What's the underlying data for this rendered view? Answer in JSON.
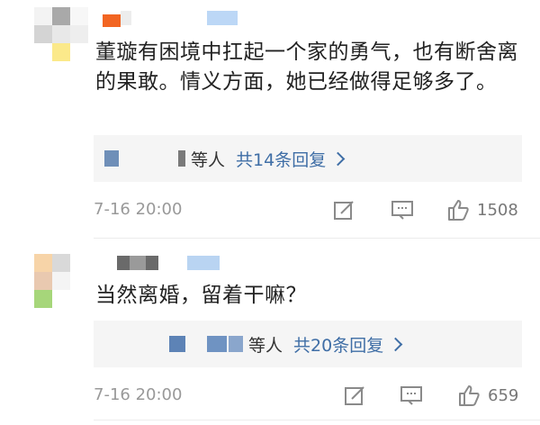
{
  "comments": [
    {
      "text": "董璇有困境中扛起一个家的勇气，也有断舍离的果敢。情义方面，她已经做得足够多了。",
      "reply_who": "等人",
      "reply_link": "共14条回复",
      "time": "7-16 20:00",
      "likes": "1508",
      "icons": [
        "share-icon",
        "comment-icon",
        "like-icon",
        "chevron-right-icon"
      ]
    },
    {
      "text": "当然离婚，留着干嘛？",
      "reply_who": "等人",
      "reply_link": "共20条回复",
      "time": "7-16 20:00",
      "likes": "659",
      "icons": [
        "share-icon",
        "comment-icon",
        "like-icon",
        "chevron-right-icon"
      ]
    }
  ],
  "colors": {
    "link": "#3f6ea6",
    "meta": "#999999",
    "reply_bg": "#f5f5f5",
    "text": "#222222"
  }
}
